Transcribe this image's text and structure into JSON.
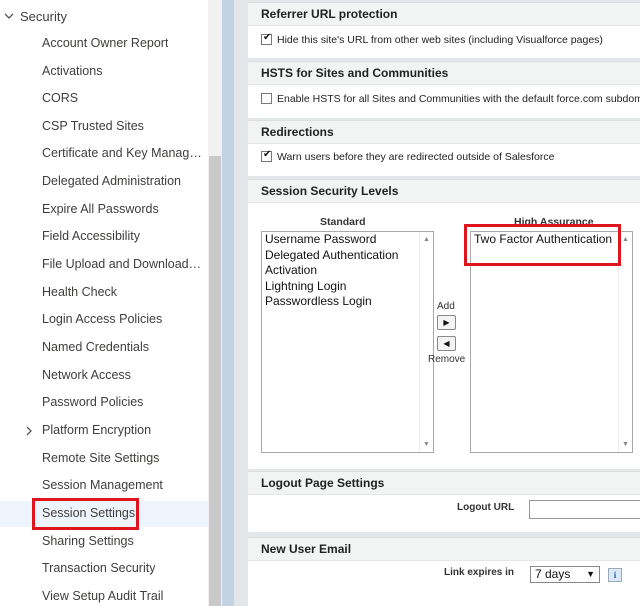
{
  "sidebar": {
    "section_label": "Security",
    "items": [
      {
        "label": "Account Owner Report"
      },
      {
        "label": "Activations"
      },
      {
        "label": "CORS"
      },
      {
        "label": "CSP Trusted Sites"
      },
      {
        "label": "Certificate and Key Management"
      },
      {
        "label": "Delegated Administration"
      },
      {
        "label": "Expire All Passwords"
      },
      {
        "label": "Field Accessibility"
      },
      {
        "label": "File Upload and Download Security"
      },
      {
        "label": "Health Check"
      },
      {
        "label": "Login Access Policies"
      },
      {
        "label": "Named Credentials"
      },
      {
        "label": "Network Access"
      },
      {
        "label": "Password Policies"
      },
      {
        "label": "Platform Encryption"
      },
      {
        "label": "Remote Site Settings"
      },
      {
        "label": "Session Management"
      },
      {
        "label": "Session Settings"
      },
      {
        "label": "Sharing Settings"
      },
      {
        "label": "Transaction Security"
      },
      {
        "label": "View Setup Audit Trail"
      }
    ]
  },
  "referrer": {
    "header": "Referrer URL protection",
    "checkbox_label": "Hide this site's URL from other web sites (including Visualforce pages)",
    "checked": true
  },
  "hsts": {
    "header": "HSTS for Sites and Communities",
    "checkbox_label": "Enable HSTS for all Sites and Communities with the default force.com subdomain",
    "checked": false
  },
  "redirections": {
    "header": "Redirections",
    "checkbox_label": "Warn users before they are redirected outside of Salesforce",
    "checked": true
  },
  "session_levels": {
    "header": "Session Security Levels",
    "standard_label": "Standard",
    "high_label": "High Assurance",
    "standard_options": [
      "Username Password",
      "Delegated Authentication",
      "Activation",
      "Lightning Login",
      "Passwordless Login"
    ],
    "high_options": [
      "Two Factor Authentication"
    ],
    "add_label": "Add",
    "remove_label": "Remove"
  },
  "logout": {
    "header": "Logout Page Settings",
    "url_label": "Logout URL",
    "url_value": ""
  },
  "new_user_email": {
    "header": "New User Email",
    "link_label": "Link expires in",
    "link_value": "7 days"
  }
}
